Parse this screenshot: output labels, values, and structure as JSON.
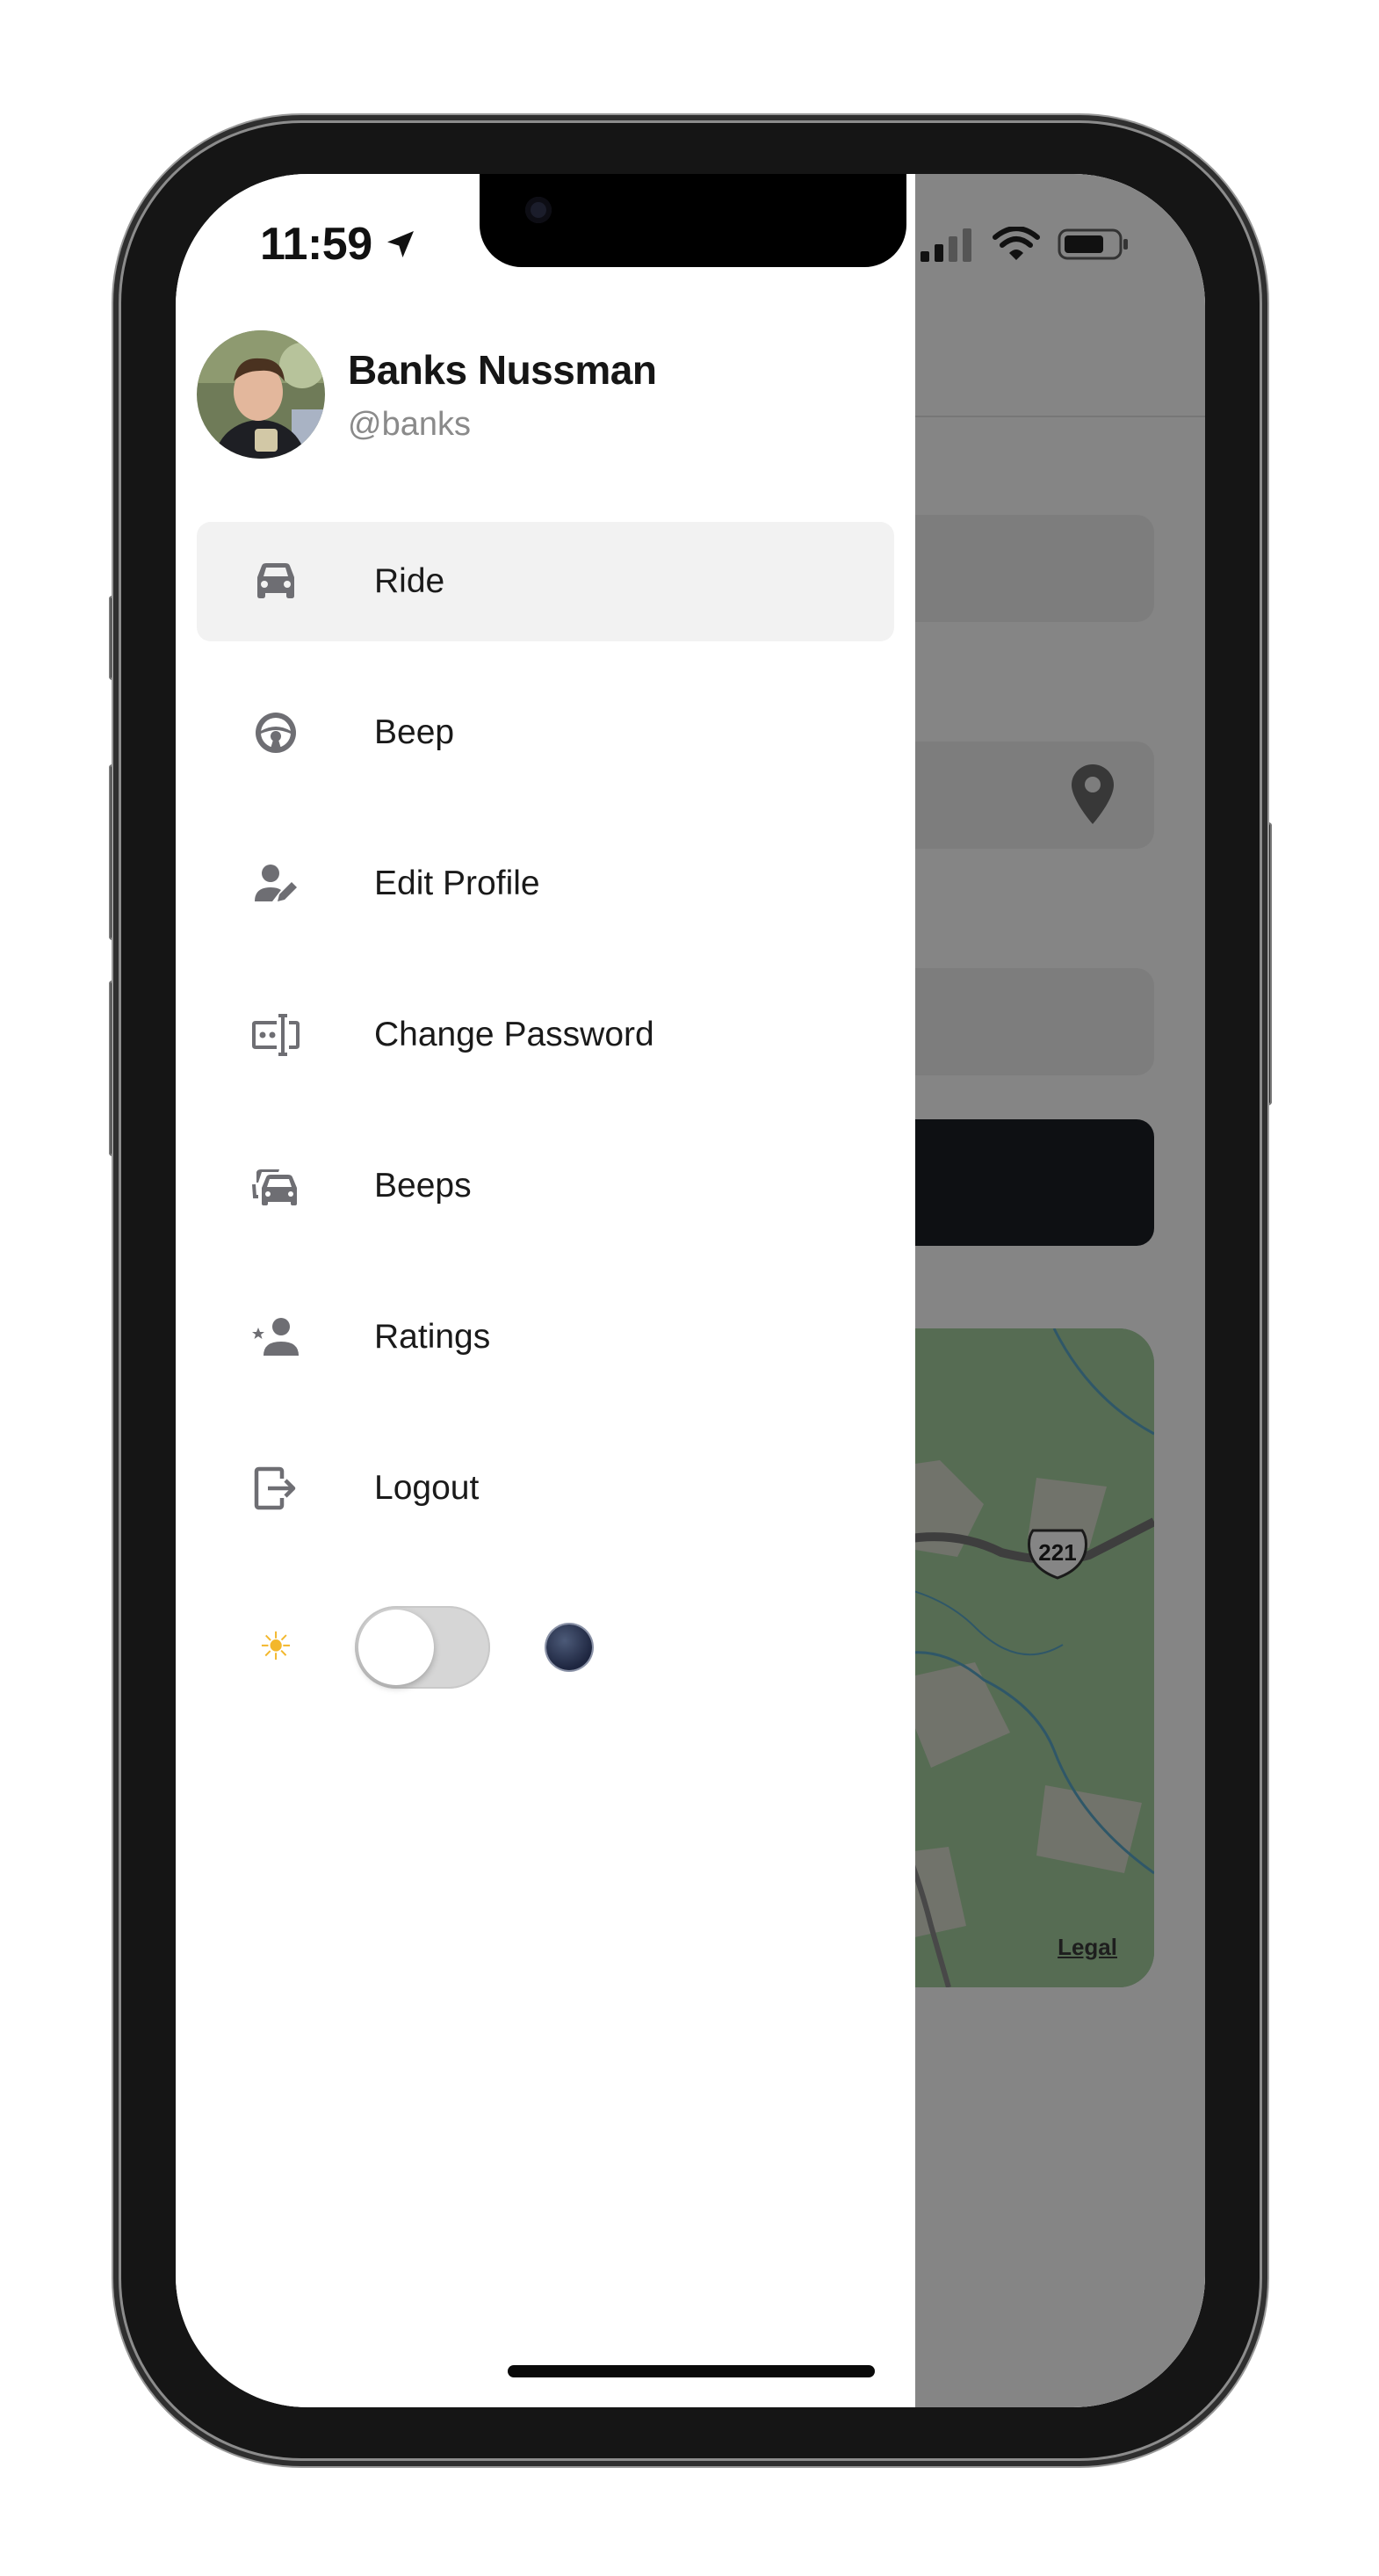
{
  "status_bar": {
    "time": "11:59",
    "location_icon": "location-arrow-icon",
    "signal_icon": "cellular-signal-icon",
    "wifi_icon": "wifi-icon",
    "battery_icon": "battery-icon"
  },
  "drawer": {
    "profile": {
      "name": "Banks Nussman",
      "username": "@banks",
      "avatar_icon": "user-avatar-photo"
    },
    "menu": [
      {
        "label": "Ride",
        "icon": "car-icon",
        "active": true
      },
      {
        "label": "Beep",
        "icon": "steering-wheel-icon",
        "active": false
      },
      {
        "label": "Edit Profile",
        "icon": "edit-profile-icon",
        "active": false
      },
      {
        "label": "Change Password",
        "icon": "password-field-icon",
        "active": false
      },
      {
        "label": "Beeps",
        "icon": "cars-multiple-icon",
        "active": false
      },
      {
        "label": "Ratings",
        "icon": "account-star-icon",
        "active": false
      },
      {
        "label": "Logout",
        "icon": "logout-icon",
        "active": false
      }
    ],
    "theme": {
      "light_icon": "sun-emoji-icon",
      "dark_icon": "moon-emoji-icon",
      "dark_mode_enabled": false
    }
  },
  "background": {
    "map": {
      "route_shield": "221",
      "legal_link": "Legal"
    }
  },
  "colors": {
    "active_item_bg": "#f2f2f2",
    "icon_gray": "#6e6e73",
    "primary_button": "#1b1f26",
    "scrim": "rgba(0,0,0,0.48)",
    "map_green": "#9fc79a"
  }
}
